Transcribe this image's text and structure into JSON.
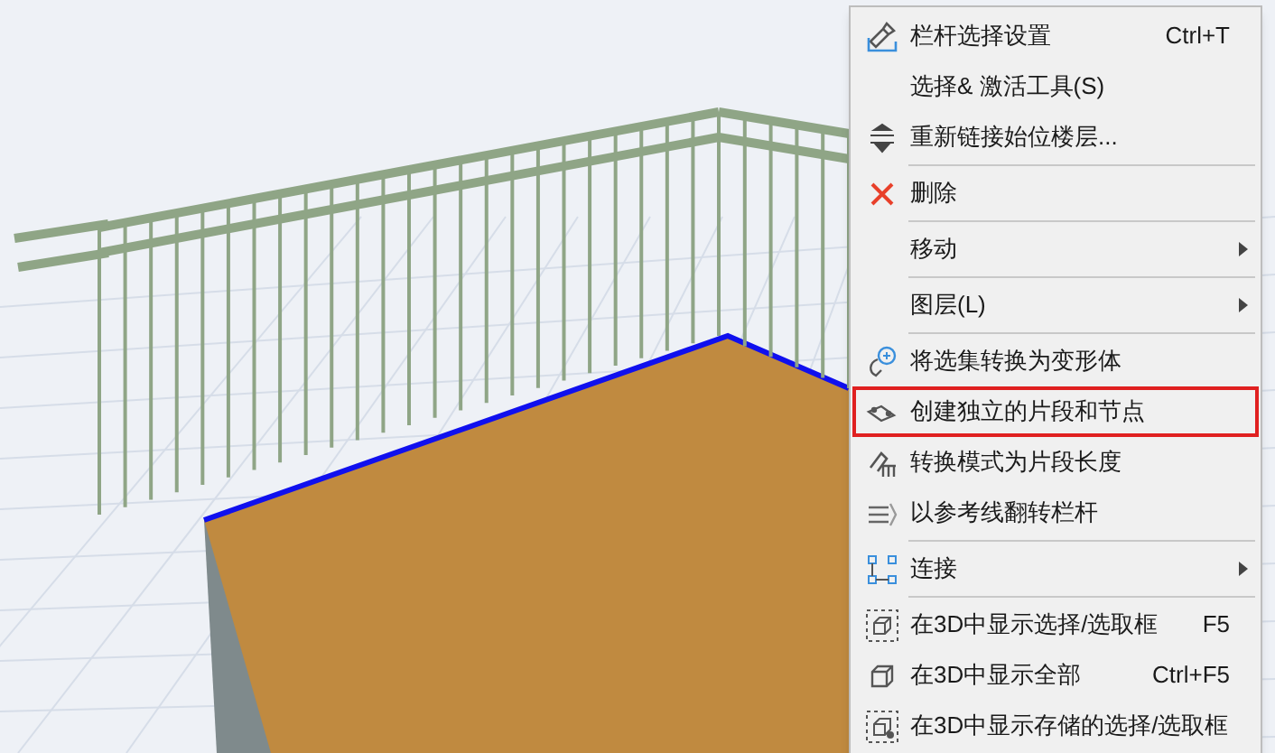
{
  "context_menu": {
    "items": [
      {
        "kind": "item",
        "label": "栏杆选择设置",
        "shortcut": "Ctrl+T",
        "submenu": false,
        "highlighted": false
      },
      {
        "kind": "item",
        "label": "选择& 激活工具(S)",
        "submenu": false,
        "highlighted": false
      },
      {
        "kind": "item",
        "label": "重新链接始位楼层...",
        "submenu": false,
        "highlighted": false
      },
      {
        "kind": "separator"
      },
      {
        "kind": "item",
        "label": "删除",
        "submenu": false,
        "highlighted": false
      },
      {
        "kind": "separator"
      },
      {
        "kind": "item",
        "label": "移动",
        "submenu": true,
        "highlighted": false
      },
      {
        "kind": "separator"
      },
      {
        "kind": "item",
        "label": "图层(L)",
        "submenu": true,
        "highlighted": false
      },
      {
        "kind": "separator"
      },
      {
        "kind": "item",
        "label": "将选集转换为变形体",
        "submenu": false,
        "highlighted": false
      },
      {
        "kind": "item",
        "label": "创建独立的片段和节点",
        "submenu": false,
        "highlighted": true
      },
      {
        "kind": "item",
        "label": "转换模式为片段长度",
        "submenu": false,
        "highlighted": false
      },
      {
        "kind": "item",
        "label": "以参考线翻转栏杆",
        "submenu": false,
        "highlighted": false
      },
      {
        "kind": "separator"
      },
      {
        "kind": "item",
        "label": "连接",
        "submenu": true,
        "highlighted": false
      },
      {
        "kind": "separator"
      },
      {
        "kind": "item",
        "label": "在3D中显示选择/选取框",
        "shortcut": "F5",
        "submenu": false,
        "highlighted": false
      },
      {
        "kind": "item",
        "label": "在3D中显示全部",
        "shortcut": "Ctrl+F5",
        "submenu": false,
        "highlighted": false
      },
      {
        "kind": "item",
        "label": "在3D中显示存储的选择/选取框",
        "submenu": false,
        "highlighted": false
      }
    ]
  }
}
